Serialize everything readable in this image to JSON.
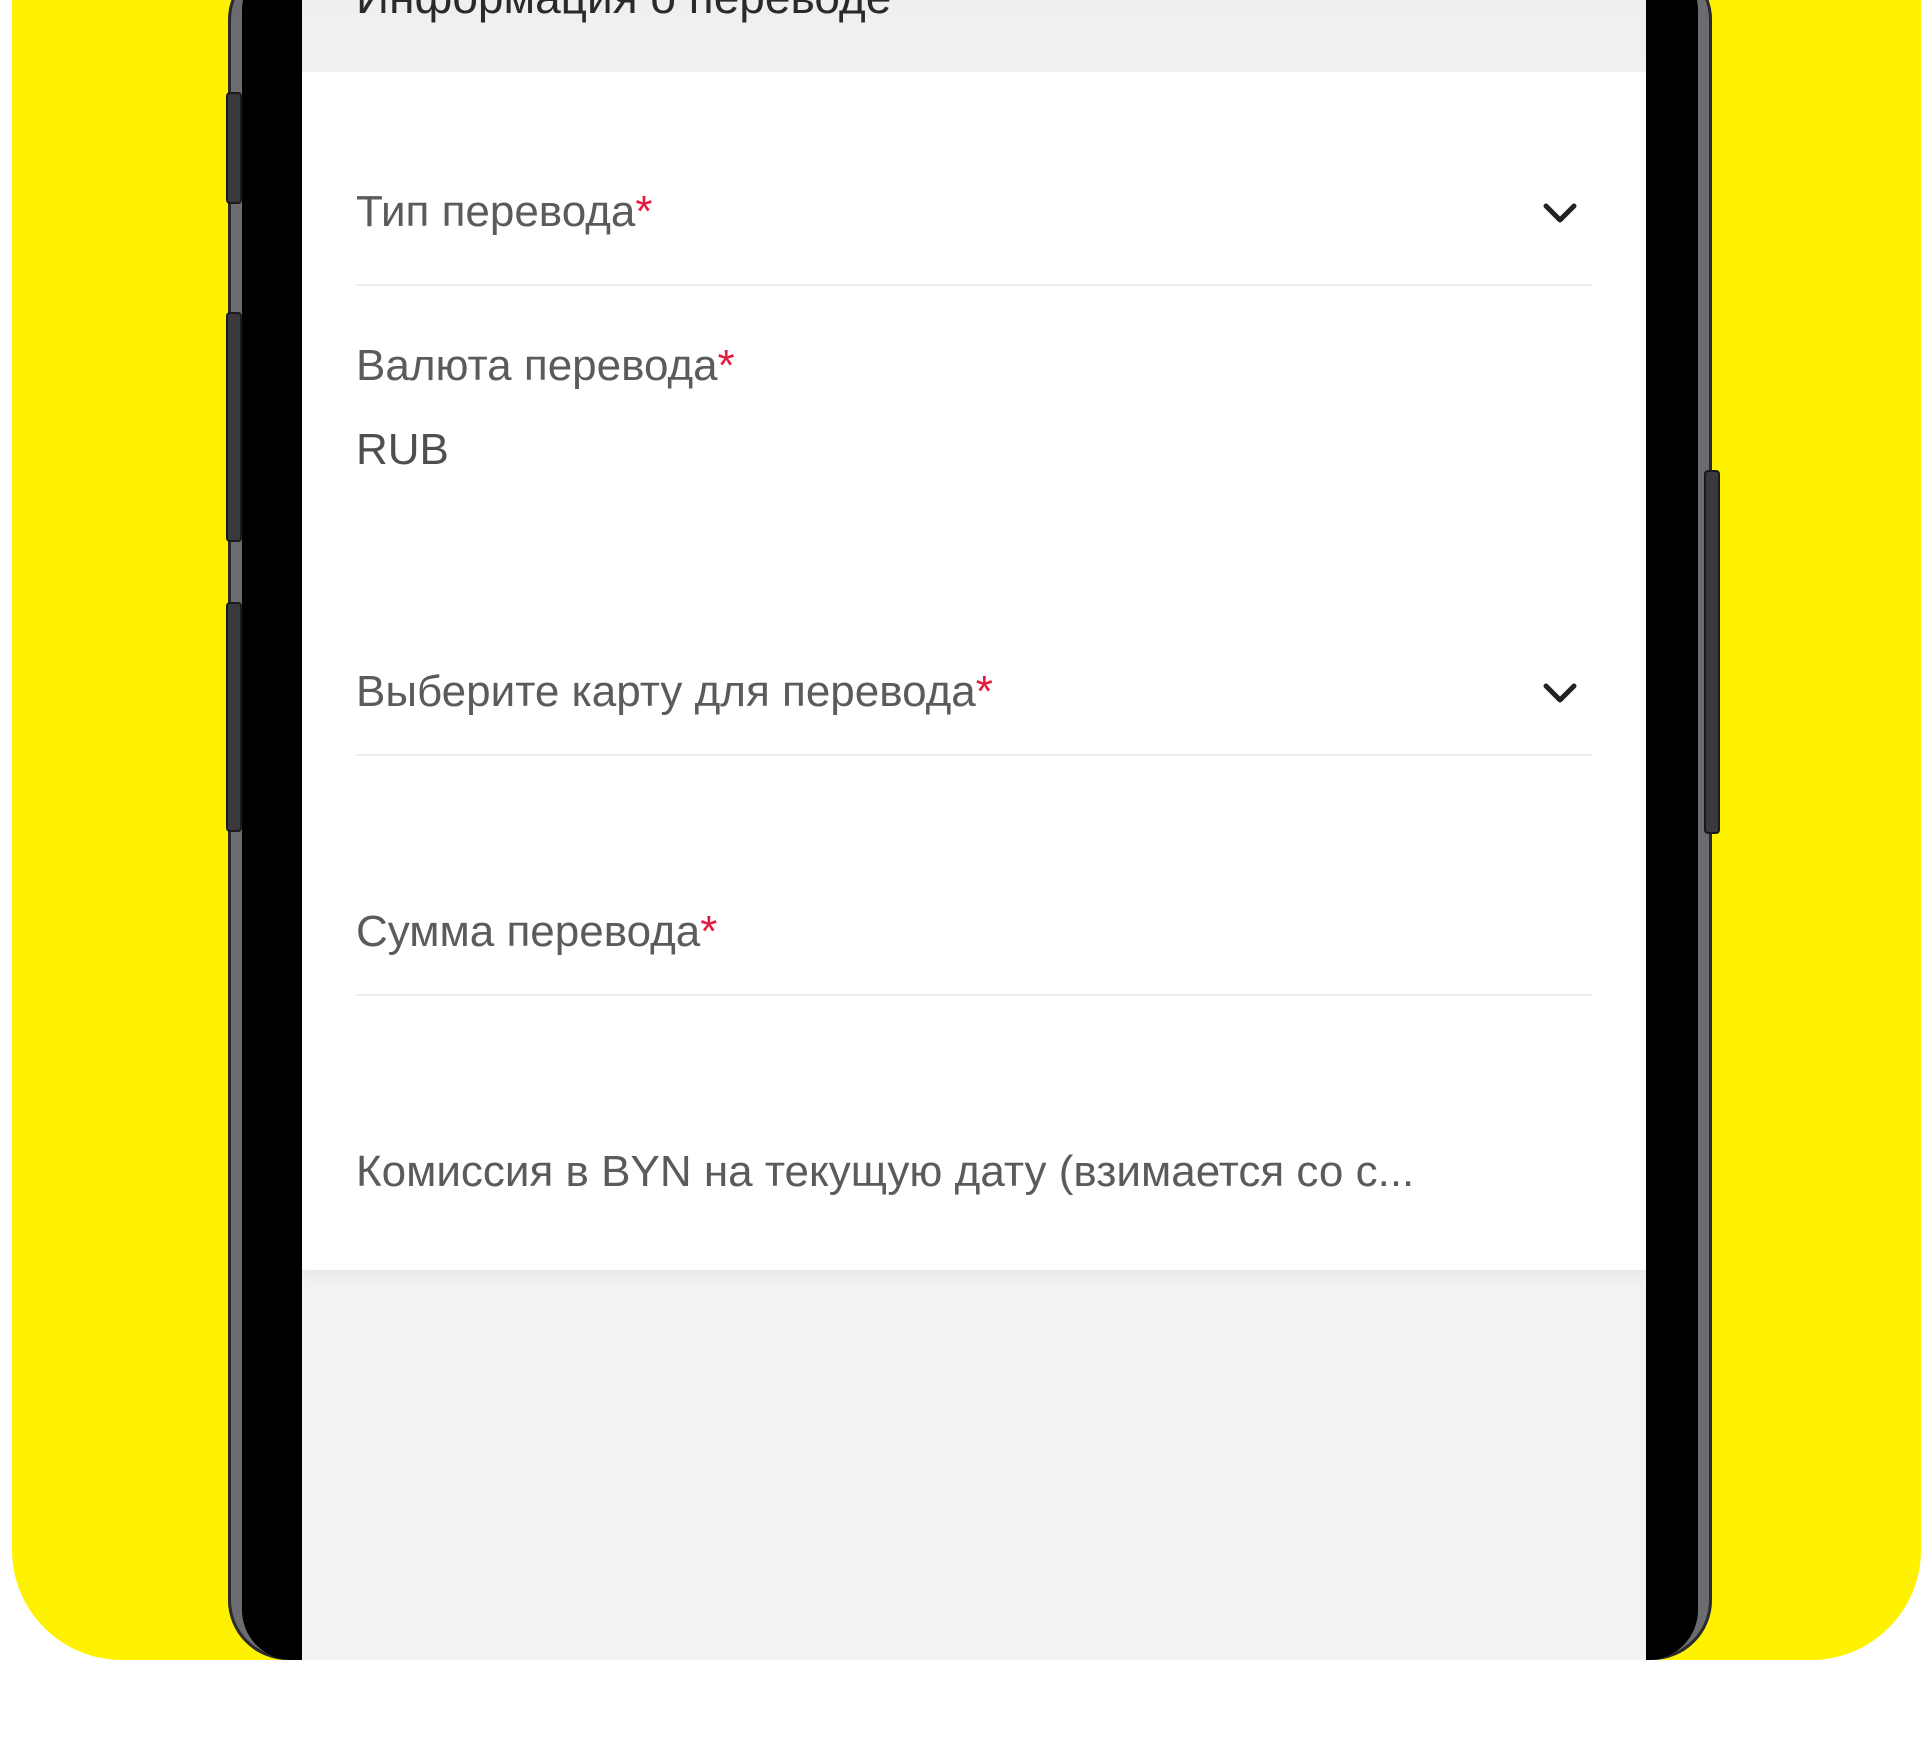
{
  "section": {
    "title": "Информация о переводе"
  },
  "fields": {
    "transfer_type": {
      "label": "Тип перевода",
      "required_mark": "*"
    },
    "currency": {
      "label": "Валюта перевода",
      "required_mark": "*",
      "value": "RUB"
    },
    "card": {
      "label": "Выберите карту для перевода",
      "required_mark": "*"
    },
    "amount": {
      "label": "Сумма перевода",
      "required_mark": "*"
    },
    "commission": {
      "label": "Комиссия в BYN на текущую дату (взимается со с..."
    }
  },
  "icons": {
    "dropdown": "chevron-down-icon"
  },
  "colors": {
    "brand_yellow": "#FFF200",
    "required": "#E31C3D"
  }
}
